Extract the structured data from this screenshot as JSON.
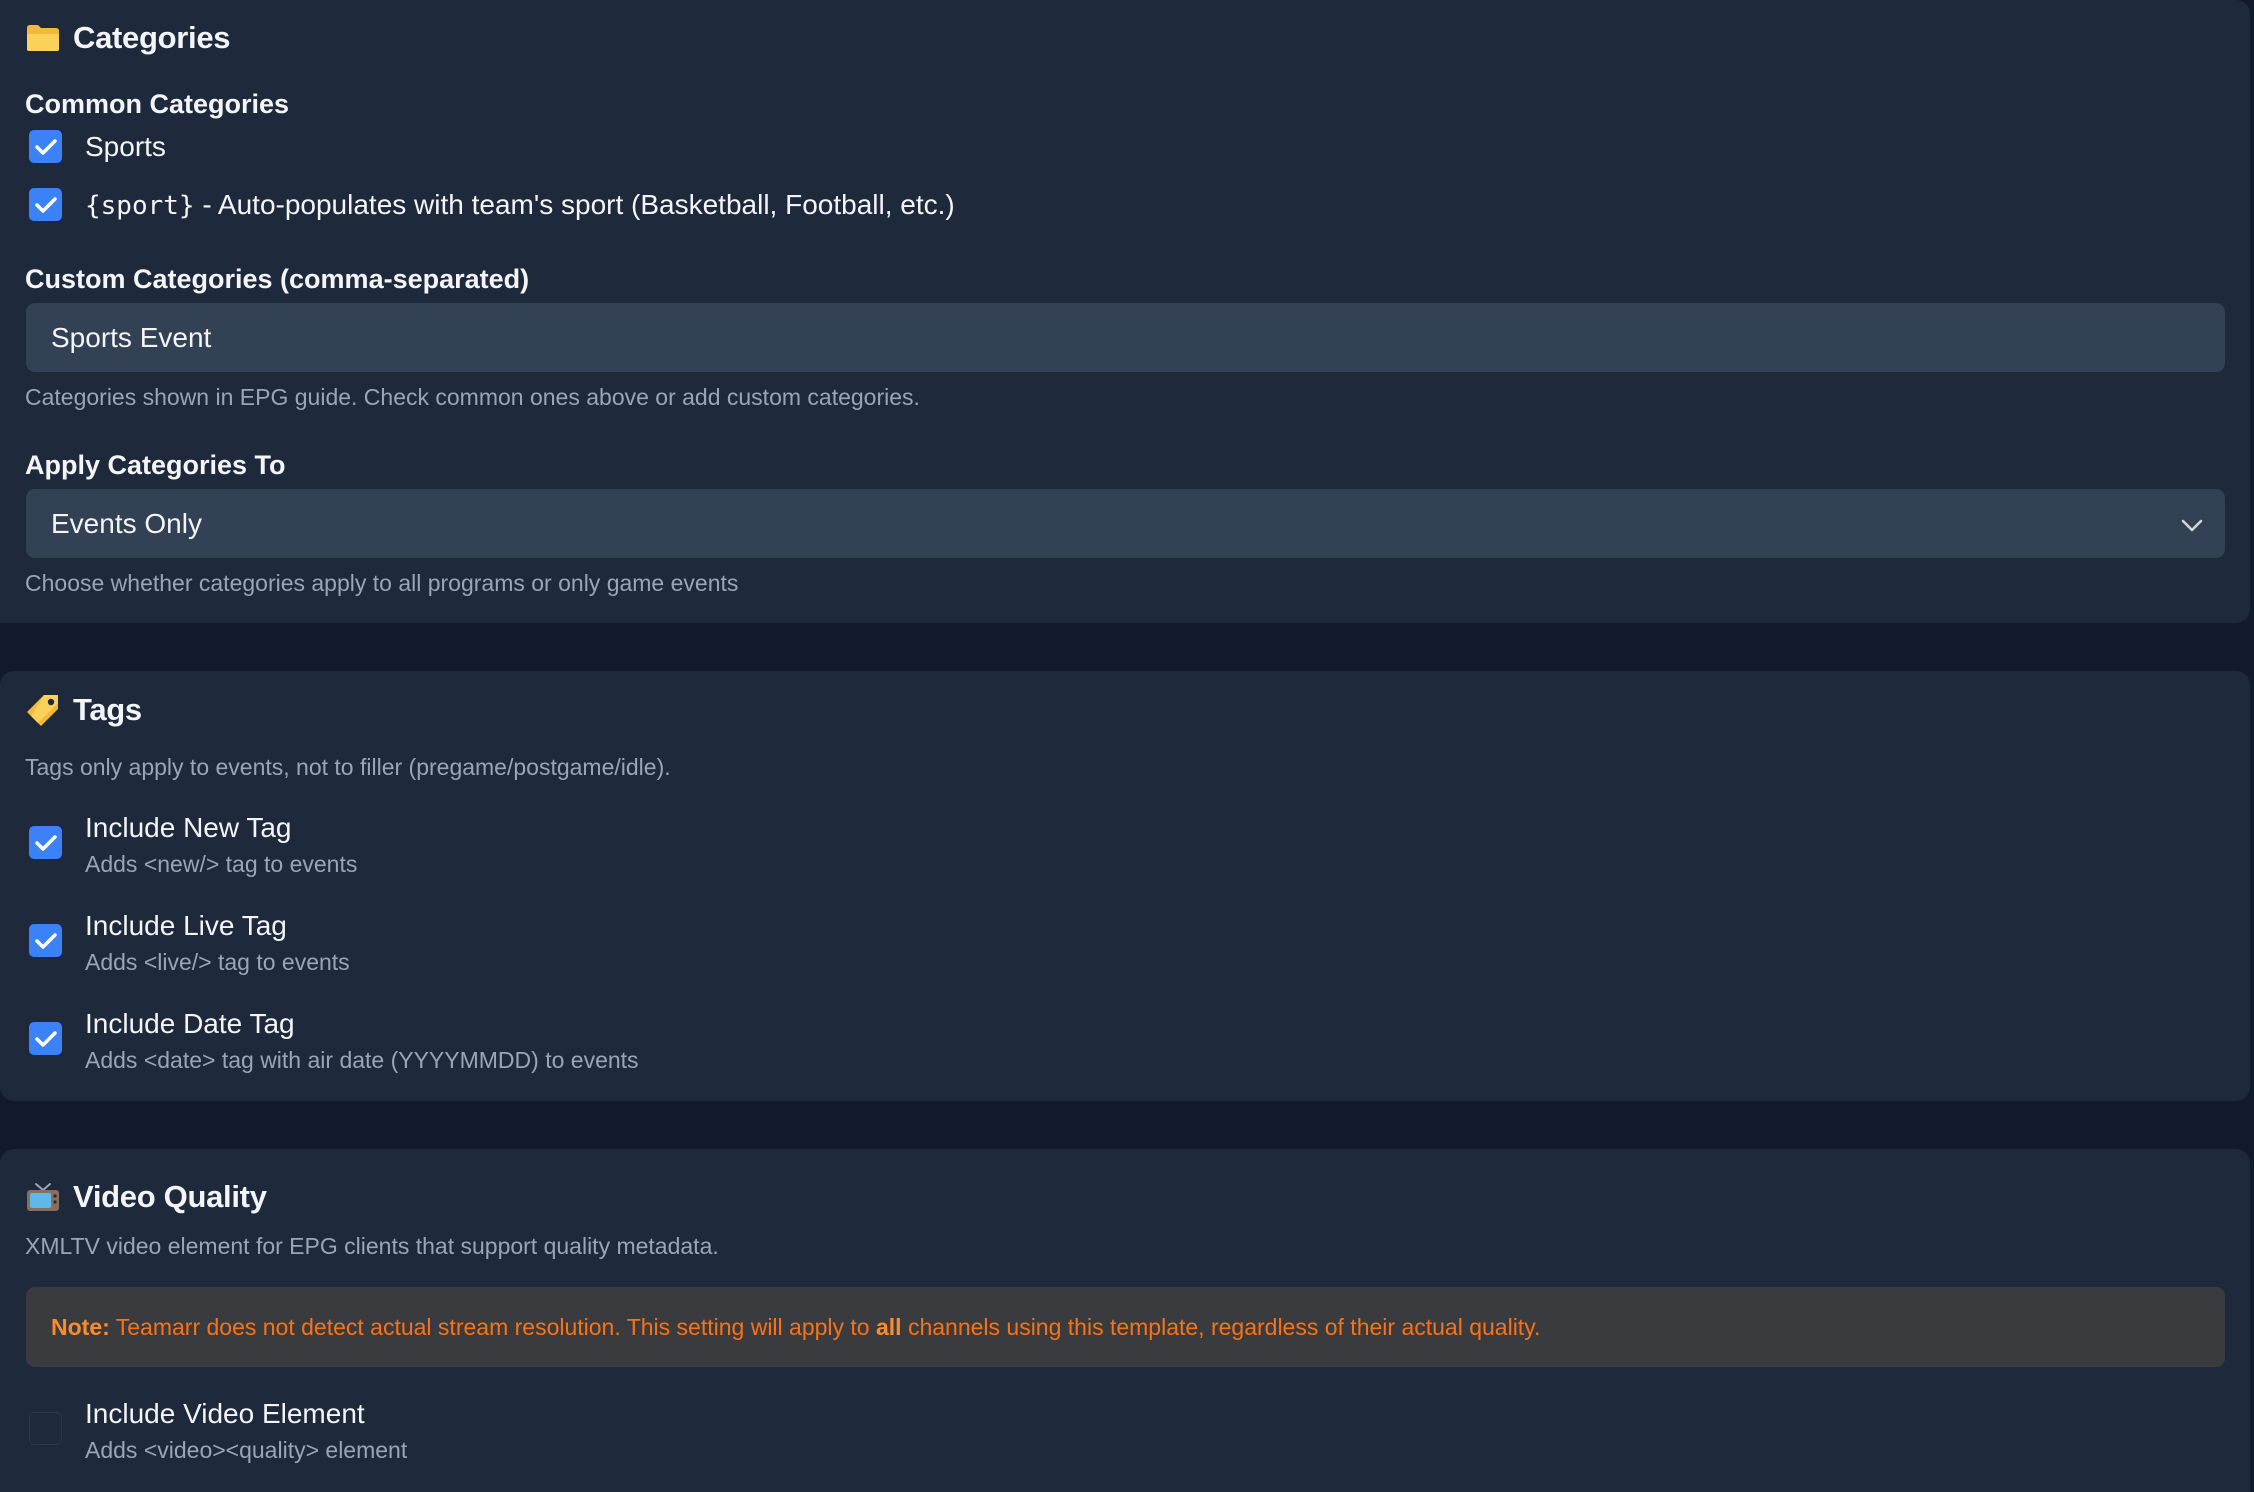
{
  "categories": {
    "title": "Categories",
    "icon": "folder-icon",
    "common_label": "Common Categories",
    "common": [
      {
        "label": "Sports",
        "checked": true
      },
      {
        "code": "{sport}",
        "label": " - Auto-populates with team's sport (Basketball, Football, etc.)",
        "checked": true
      }
    ],
    "custom_label": "Custom Categories (comma-separated)",
    "custom_value": "Sports Event",
    "custom_help": "Categories shown in EPG guide. Check common ones above or add custom categories.",
    "apply_label": "Apply Categories To",
    "apply_value": "Events Only",
    "apply_help": "Choose whether categories apply to all programs or only game events"
  },
  "tags": {
    "title": "Tags",
    "icon": "tag-icon",
    "description": "Tags only apply to events, not to filler (pregame/postgame/idle).",
    "items": [
      {
        "title": "Include New Tag",
        "sub": "Adds <new/> tag to events",
        "checked": true
      },
      {
        "title": "Include Live Tag",
        "sub": "Adds <live/> tag to events",
        "checked": true
      },
      {
        "title": "Include Date Tag",
        "sub": "Adds <date> tag with air date (YYYYMMDD) to events",
        "checked": true
      }
    ]
  },
  "video": {
    "title": "Video Quality",
    "icon": "tv-icon",
    "description": "XMLTV video element for EPG clients that support quality metadata.",
    "note_label": "Note:",
    "note_before": " Teamarr does not detect actual stream resolution. This setting will apply to ",
    "note_bold": "all",
    "note_after": " channels using this template, regardless of their actual quality.",
    "item": {
      "title": "Include Video Element",
      "sub": "Adds <video><quality> element",
      "checked": false
    }
  },
  "colors": {
    "background": "#111a2c",
    "card": "#1e293b",
    "input": "#334155",
    "accent": "#3b82f6",
    "note_text": "#f97316"
  }
}
